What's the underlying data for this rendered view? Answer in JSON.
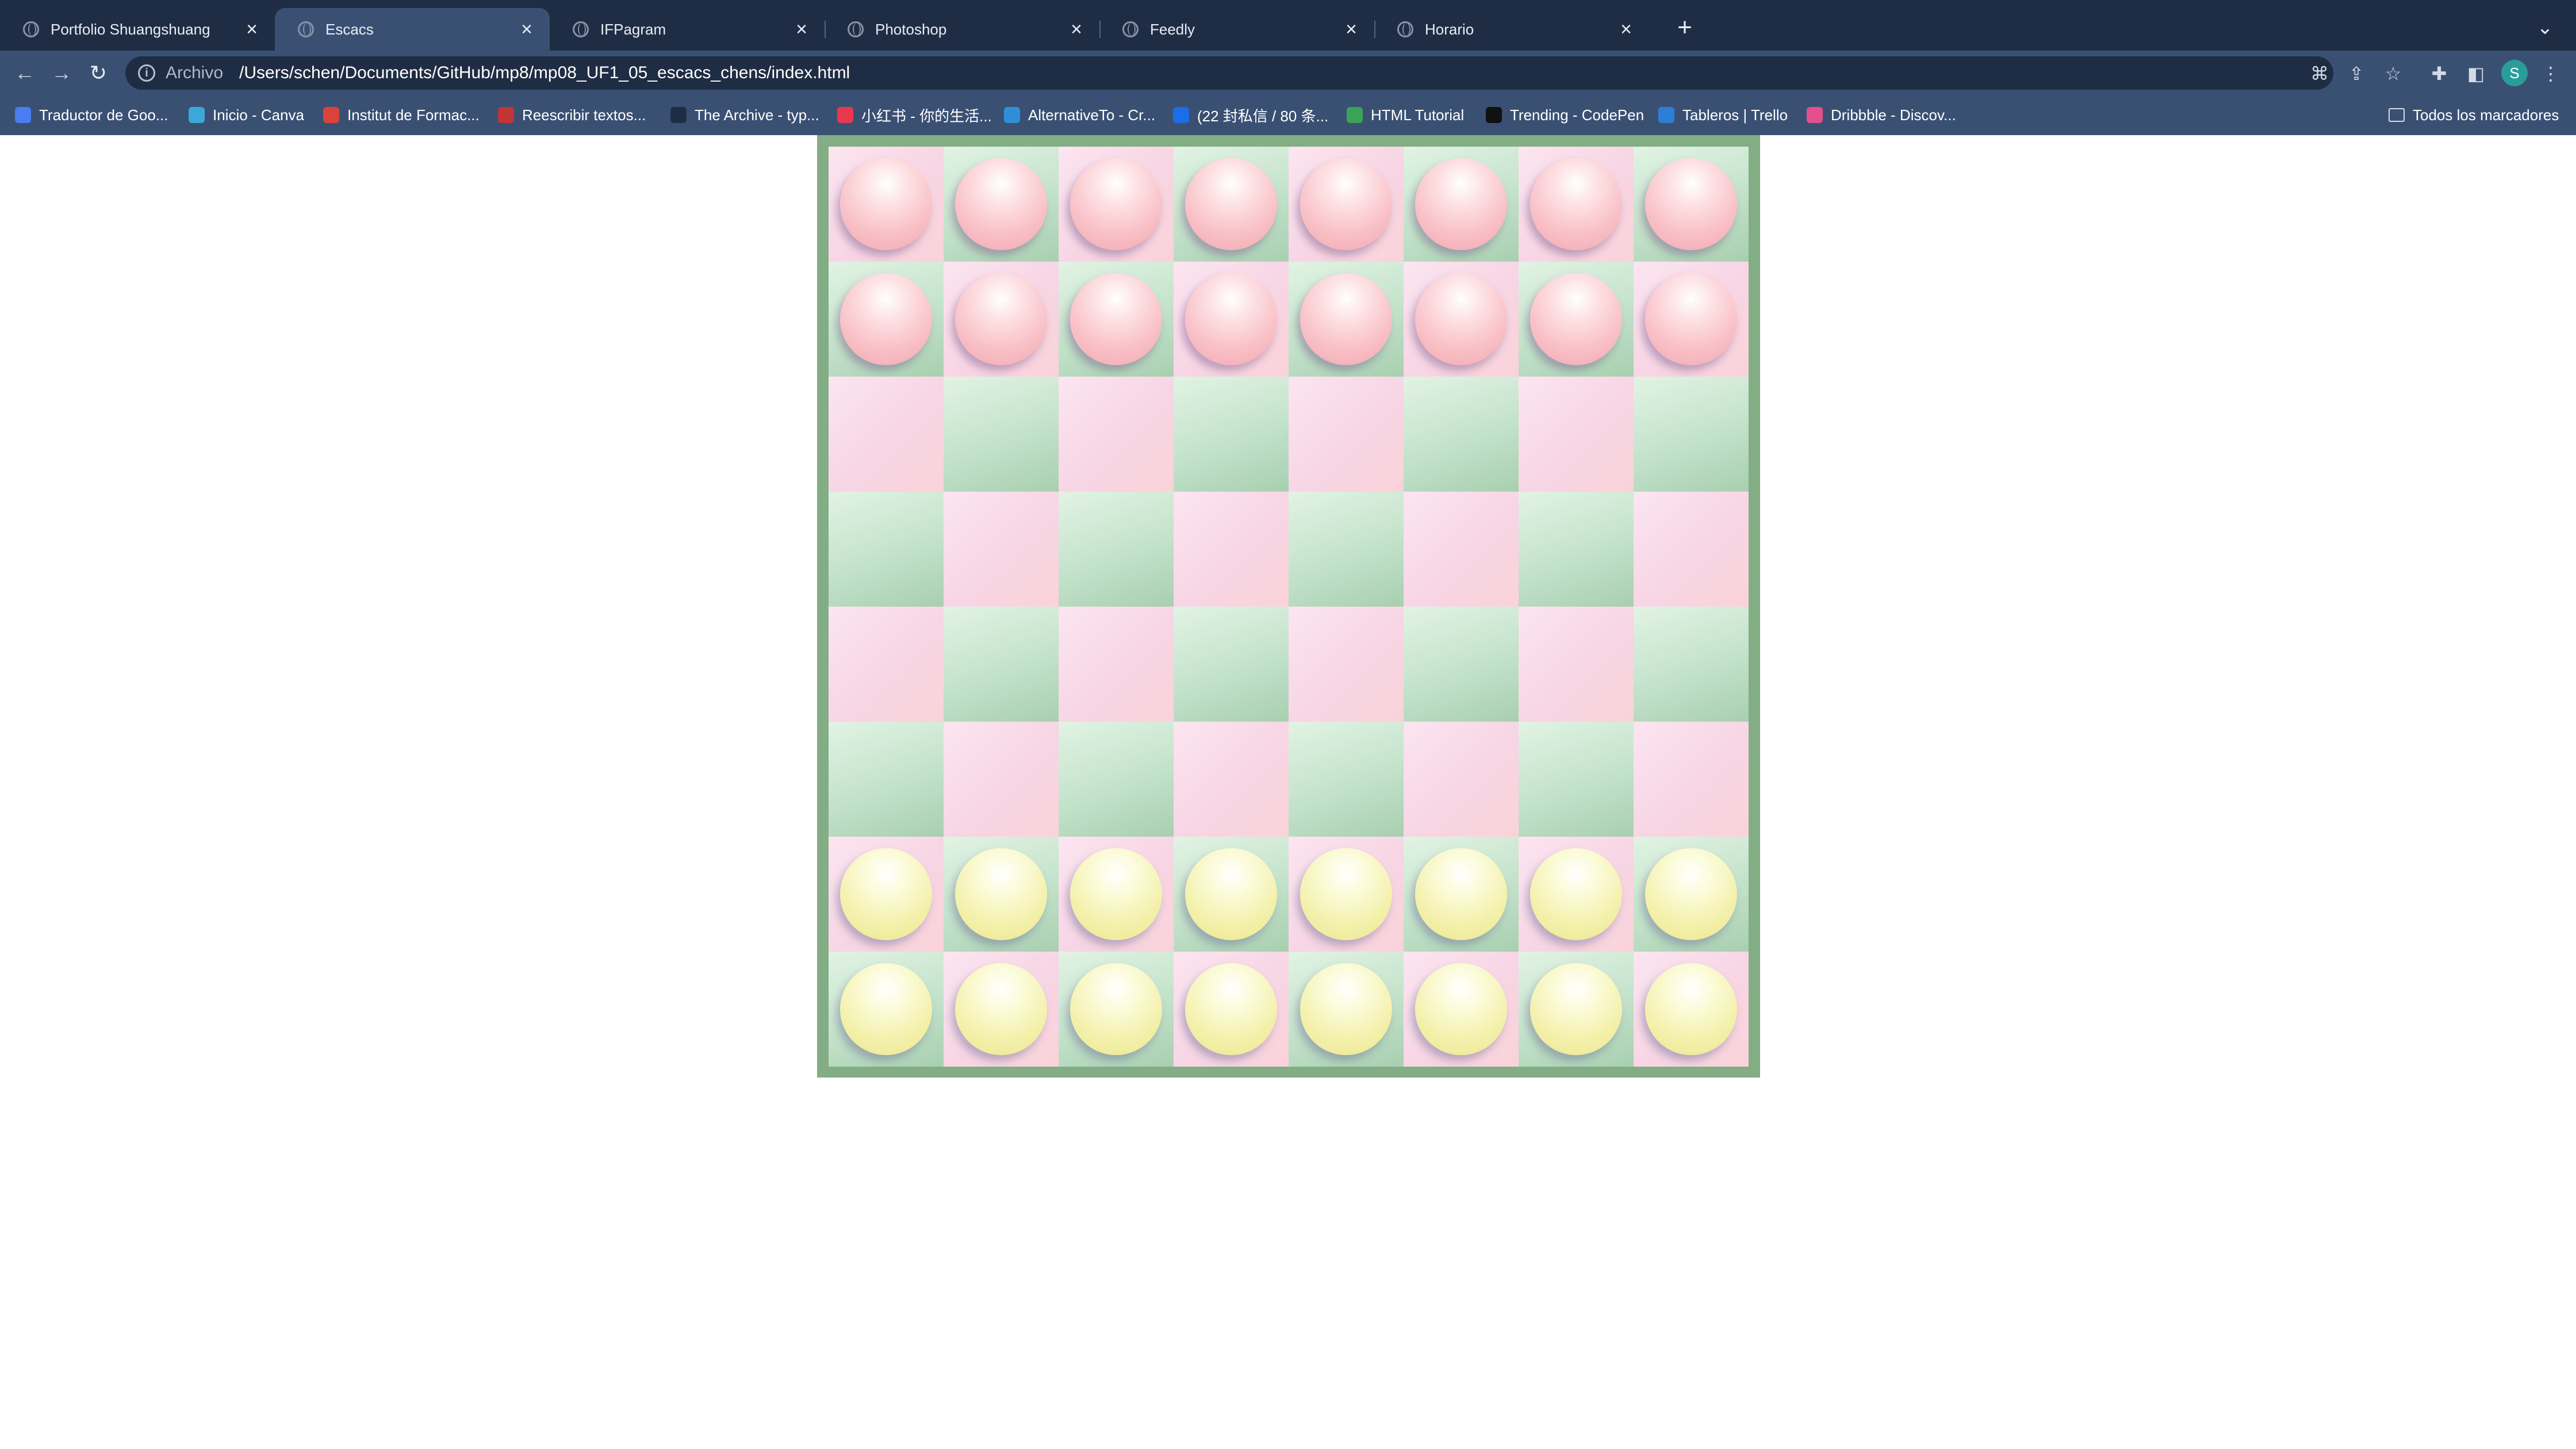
{
  "browser": {
    "tabs": [
      {
        "title": "Portfolio Shuangshuang",
        "active": false
      },
      {
        "title": "Escacs",
        "active": true
      },
      {
        "title": "IFPagram",
        "active": false
      },
      {
        "title": "Photoshop",
        "active": false
      },
      {
        "title": "Feedly",
        "active": false
      },
      {
        "title": "Horario",
        "active": false
      }
    ],
    "new_tab_label": "+",
    "tab_close_glyph": "×",
    "address": {
      "scheme_label": "Archivo",
      "url": "/Users/schen/Documents/GitHub/mp8/mp08_UF1_05_escacs_chens/index.html"
    },
    "profile_initial": "S",
    "bookmarks": [
      {
        "label": "Traductor de Goo...",
        "icon": "google-translate-icon",
        "color": "#4a7df0"
      },
      {
        "label": "Inicio - Canva",
        "icon": "canva-icon",
        "color": "#3aa8d8"
      },
      {
        "label": "Institut de Formac...",
        "icon": "institut-icon",
        "color": "#d9433a"
      },
      {
        "label": "Reescribir textos...",
        "icon": "rewrite-icon",
        "color": "#c23535"
      },
      {
        "label": "The Archive - typ...",
        "icon": "archive-slash-icon",
        "color": "#1f2d44"
      },
      {
        "label": "小红书 - 你的生活...",
        "icon": "xiaohongshu-icon",
        "color": "#e8384f"
      },
      {
        "label": "AlternativeTo - Cr...",
        "icon": "alternativeto-icon",
        "color": "#2f8fd6"
      },
      {
        "label": "(22 封私信 / 80 条...",
        "icon": "zhihu-icon",
        "color": "#1b6ee8"
      },
      {
        "label": "HTML Tutorial",
        "icon": "w3schools-icon",
        "color": "#3aa356"
      },
      {
        "label": "Trending - CodePen",
        "icon": "codepen-icon",
        "color": "#111111"
      },
      {
        "label": "Tableros | Trello",
        "icon": "trello-icon",
        "color": "#2c7fd6"
      },
      {
        "label": "Dribbble - Discov...",
        "icon": "dribbble-icon",
        "color": "#e3508b"
      }
    ],
    "all_bookmarks_label": "Todos los marcadores"
  },
  "board": {
    "rows": 8,
    "cols": 8,
    "pink_piece_rows": [
      0,
      1
    ],
    "yellow_piece_rows": [
      6,
      7
    ],
    "colors": {
      "frame": "#83ad84",
      "light_square": "#f8d8e6",
      "dark_square": "#c6e4cd",
      "pink_piece": "#f9c1c7",
      "yellow_piece": "#f4f1ad"
    }
  }
}
